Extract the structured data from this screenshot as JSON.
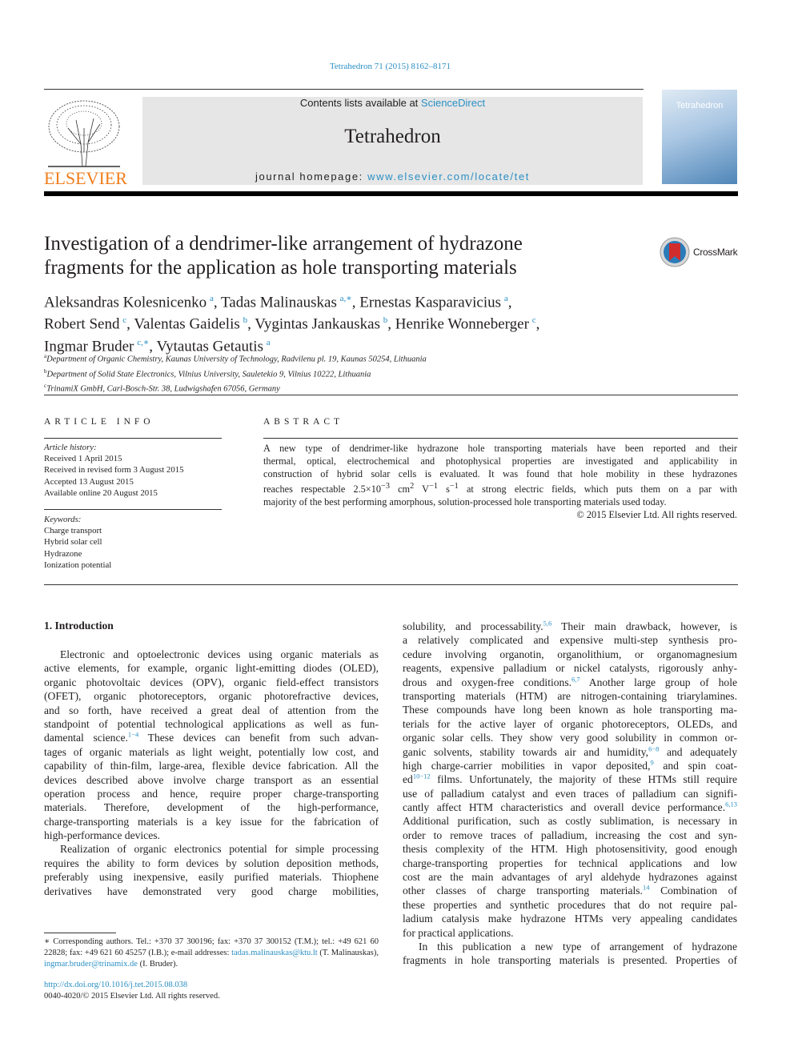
{
  "header": {
    "citation": "Tetrahedron 71 (2015) 8162–8171",
    "contents_prefix": "Contents lists available at ",
    "contents_link": "ScienceDirect",
    "journal_title": "Tetrahedron",
    "homepage_prefix": "journal homepage: ",
    "homepage_link": "www.elsevier.com/locate/tet",
    "publisher_logo": "ELSEVIER",
    "cover_title": "Tetrahedron",
    "crossmark": "CrossMark"
  },
  "colors": {
    "link": "#2a8fc4",
    "elsevier": "#f07d1a"
  },
  "article": {
    "title_lines": [
      "Investigation of a dendrimer-like arrangement of hydrazone",
      "fragments for the application as hole transporting materials"
    ],
    "authors": [
      [
        {
          "name": "Aleksandras Kolesnicenko",
          "aff": "a"
        },
        {
          "name": "Tadas Malinauskas",
          "aff": "a,∗"
        },
        {
          "name": "Ernestas Kasparavicius",
          "aff": "a"
        }
      ],
      [
        {
          "name": "Robert Send",
          "aff": "c"
        },
        {
          "name": "Valentas Gaidelis",
          "aff": "b"
        },
        {
          "name": "Vygintas Jankauskas",
          "aff": "b"
        },
        {
          "name": "Henrike Wonneberger",
          "aff": "c"
        }
      ],
      [
        {
          "name": "Ingmar Bruder",
          "aff": "c,∗"
        },
        {
          "name": "Vytautas Getautis",
          "aff": "a"
        }
      ]
    ],
    "affiliations": [
      {
        "key": "a",
        "text": "Department of Organic Chemistry, Kaunas University of Technology, Radvilenu pl. 19, Kaunas 50254, Lithuania"
      },
      {
        "key": "b",
        "text": "Department of Solid State Electronics, Vilnius University, Sauletekio 9, Vilnius 10222, Lithuania"
      },
      {
        "key": "c",
        "text": "TrinamiX GmbH, Carl-Bosch-Str. 38, Ludwigshafen 67056, Germany"
      }
    ]
  },
  "article_info": {
    "heading": "ARTICLE INFO",
    "history_label": "Article history:",
    "history": [
      "Received 1 April 2015",
      "Received in revised form 3 August 2015",
      "Accepted 13 August 2015",
      "Available online 20 August 2015"
    ],
    "keywords_label": "Keywords:",
    "keywords": [
      "Charge transport",
      "Hybrid solar cell",
      "Hydrazone",
      "Ionization potential"
    ]
  },
  "abstract": {
    "heading": "ABSTRACT",
    "lines": [
      [
        "A new type of dendrimer-like hydrazone hole transporting materials have been reported and their"
      ],
      [
        "thermal, optical, electrochemical and photophysical properties are investigated and applicability in"
      ],
      [
        "construction of hybrid solar cells is evaluated. It was found that hole mobility in these hydrazones"
      ],
      [
        "reaches respectable 2.5×10",
        {
          "sup": "−3"
        },
        " cm",
        {
          "sup": "2"
        },
        " V",
        {
          "sup": "−1"
        },
        " s",
        {
          "sup": "−1"
        },
        " at strong electric fields, which puts them on a par with"
      ],
      [
        "majority of the best performing amorphous, solution-processed hole transporting materials used today."
      ]
    ],
    "copyright": "© 2015 Elsevier Ltd. All rights reserved."
  },
  "intro": {
    "heading": "1.  Introduction",
    "left_lines": [
      {
        "ind": true,
        "seg": [
          "Electronic and optoelectronic devices using organic materials as"
        ]
      },
      {
        "seg": [
          "active elements, for example, organic light-emitting diodes (OLED),"
        ]
      },
      {
        "seg": [
          "organic photovoltaic devices (OPV), organic field-effect transistors"
        ]
      },
      {
        "seg": [
          "(OFET), organic photoreceptors, organic photorefractive devices,"
        ]
      },
      {
        "seg": [
          "and so forth, have received a great deal of attention from the"
        ]
      },
      {
        "seg": [
          "standpoint of potential technological applications as well as fun-"
        ]
      },
      {
        "seg": [
          "damental science.",
          {
            "sup": "1−4"
          },
          " These devices can benefit from such advan-"
        ]
      },
      {
        "seg": [
          "tages of organic materials as light weight, potentially low cost, and"
        ]
      },
      {
        "seg": [
          "capability of thin-film, large-area, flexible device fabrication. All the"
        ]
      },
      {
        "seg": [
          "devices described above involve charge transport as an essential"
        ]
      },
      {
        "seg": [
          "operation process and hence, require proper charge-transporting"
        ]
      },
      {
        "seg": [
          "materials. Therefore, development of the high-performance,"
        ]
      },
      {
        "seg": [
          "charge-transporting materials is a key issue for the fabrication of"
        ]
      },
      {
        "last": true,
        "seg": [
          "high-performance devices."
        ]
      },
      {
        "ind": true,
        "seg": [
          "Realization of organic electronics potential for simple processing"
        ]
      },
      {
        "seg": [
          "requires the ability to form devices by solution deposition methods,"
        ]
      },
      {
        "seg": [
          "preferably using inexpensive, easily purified materials. Thiophene"
        ]
      },
      {
        "seg": [
          "derivatives have demonstrated very good charge mobilities,"
        ]
      }
    ],
    "right_lines": [
      {
        "seg": [
          "solubility, and processability.",
          {
            "sup": "5,6"
          },
          " Their main drawback, however, is"
        ]
      },
      {
        "seg": [
          "a relatively complicated and expensive multi-step synthesis pro-"
        ]
      },
      {
        "seg": [
          "cedure involving organotin, organolithium, or organomagnesium"
        ]
      },
      {
        "seg": [
          "reagents, expensive palladium or nickel catalysts, rigorously anhy-"
        ]
      },
      {
        "seg": [
          "drous and oxygen-free conditions.",
          {
            "sup": "6,7"
          },
          " Another large group of hole"
        ]
      },
      {
        "seg": [
          "transporting materials (HTM) are nitrogen-containing triarylamines."
        ]
      },
      {
        "seg": [
          "These compounds have long been known as hole transporting ma-"
        ]
      },
      {
        "seg": [
          "terials for the active layer of organic photoreceptors, OLEDs, and"
        ]
      },
      {
        "seg": [
          "organic solar cells. They show very good solubility in common or-"
        ]
      },
      {
        "seg": [
          "ganic solvents, stability towards air and humidity,",
          {
            "sup": "6−8"
          },
          " and adequately"
        ]
      },
      {
        "seg": [
          "high charge-carrier mobilities in vapor deposited,",
          {
            "sup": "9"
          },
          " and spin coat-"
        ]
      },
      {
        "seg": [
          "ed",
          {
            "sup": "10−12"
          },
          " films. Unfortunately, the majority of these HTMs still require"
        ]
      },
      {
        "seg": [
          "use of palladium catalyst and even traces of palladium can signifi-"
        ]
      },
      {
        "seg": [
          "cantly affect HTM characteristics and overall device performance.",
          {
            "sup": "6,13"
          }
        ]
      },
      {
        "seg": [
          "Additional purification, such as costly sublimation, is necessary in"
        ]
      },
      {
        "seg": [
          "order to remove traces of palladium, increasing the cost and syn-"
        ]
      },
      {
        "seg": [
          "thesis complexity of the HTM. High photosensitivity, good enough"
        ]
      },
      {
        "seg": [
          "charge-transporting properties for technical applications and low"
        ]
      },
      {
        "seg": [
          "cost are the main advantages of aryl aldehyde hydrazones against"
        ]
      },
      {
        "seg": [
          "other classes of charge transporting materials.",
          {
            "sup": "14"
          },
          " Combination of"
        ]
      },
      {
        "seg": [
          "these properties and synthetic procedures that do not require pal-"
        ]
      },
      {
        "seg": [
          "ladium catalysis make hydrazone HTMs very appealing candidates"
        ]
      },
      {
        "last": true,
        "seg": [
          "for practical applications."
        ]
      },
      {
        "ind": true,
        "seg": [
          "In this publication a new type of arrangement of hydrazone"
        ]
      },
      {
        "seg": [
          "fragments in hole transporting materials is presented. Properties of"
        ]
      }
    ]
  },
  "footnote": {
    "text": "∗ Corresponding authors. Tel.: +370 37 300196; fax: +370 37 300152 (T.M.); tel.: +49 621 60 22828; fax: +49 621 60 45257 (I.B.); e-mail addresses: ",
    "email1": "tadas.malinauskas@ktu.lt",
    "email1_who": " (T. Malinauskas), ",
    "email2": "ingmar.bruder@trinamix.de",
    "email2_who": " (I. Bruder).",
    "doi": "http://dx.doi.org/10.1016/j.tet.2015.08.038",
    "issn": "0040-4020/© 2015 Elsevier Ltd. All rights reserved."
  }
}
